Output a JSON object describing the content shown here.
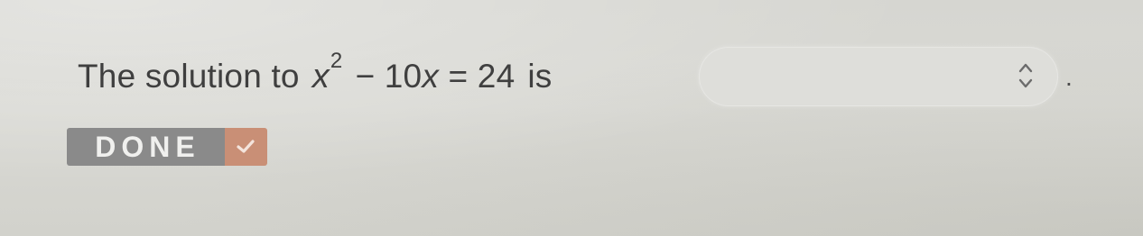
{
  "question": {
    "prefix": "The solution to",
    "variable": "x",
    "exponent": "2",
    "expression_rest_1": "− 10",
    "expression_var_2": "x",
    "expression_rest_2": " = 24",
    "suffix": "is",
    "period": "."
  },
  "answer_dropdown": {
    "selected_value": "",
    "icon": "chevron-updown-icon"
  },
  "done_button": {
    "label": "DONE",
    "icon": "check-icon",
    "label_color": "#8a8a8a",
    "icon_bg_color": "#c98f76"
  }
}
